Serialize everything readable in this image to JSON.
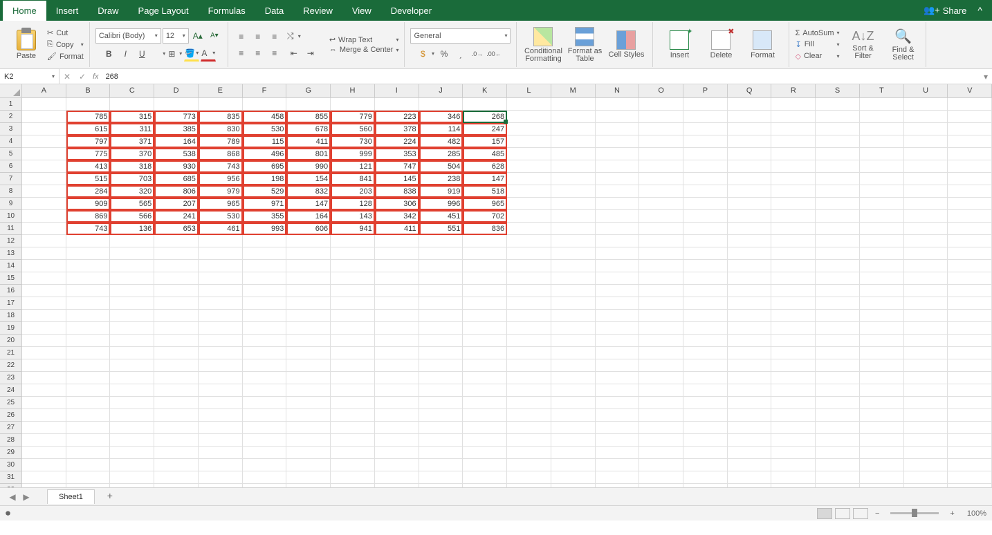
{
  "tabs": [
    "Home",
    "Insert",
    "Draw",
    "Page Layout",
    "Formulas",
    "Data",
    "Review",
    "View",
    "Developer"
  ],
  "share": "Share",
  "clipboard": {
    "paste": "Paste",
    "cut": "Cut",
    "copy": "Copy",
    "format": "Format"
  },
  "font": {
    "name": "Calibri (Body)",
    "size": "12",
    "bold": "B",
    "italic": "I",
    "underline": "U",
    "inc": "A",
    "dec": "A"
  },
  "align": {
    "wrap": "Wrap Text",
    "merge": "Merge & Center"
  },
  "number": {
    "format": "General"
  },
  "styles": {
    "cf": "Conditional Formatting",
    "fat": "Format as Table",
    "cs": "Cell Styles"
  },
  "cells": {
    "insert": "Insert",
    "delete": "Delete",
    "format": "Format"
  },
  "editing": {
    "autosum": "AutoSum",
    "fill": "Fill",
    "clear": "Clear",
    "sort": "Sort & Filter",
    "find": "Find & Select"
  },
  "cellref": "K2",
  "formula_val": "268",
  "columns": [
    "A",
    "B",
    "C",
    "D",
    "E",
    "F",
    "G",
    "H",
    "I",
    "J",
    "K",
    "L",
    "M",
    "N",
    "O",
    "P",
    "Q",
    "R",
    "S",
    "T",
    "U",
    "V"
  ],
  "total_rows": 35,
  "data_rows": [
    [
      785,
      315,
      773,
      835,
      458,
      855,
      779,
      223,
      346,
      268
    ],
    [
      615,
      311,
      385,
      830,
      530,
      678,
      560,
      378,
      114,
      247
    ],
    [
      797,
      371,
      164,
      789,
      115,
      411,
      730,
      224,
      482,
      157
    ],
    [
      775,
      370,
      538,
      868,
      496,
      801,
      999,
      353,
      285,
      485
    ],
    [
      413,
      318,
      930,
      743,
      695,
      990,
      121,
      747,
      504,
      628
    ],
    [
      515,
      703,
      685,
      956,
      198,
      154,
      841,
      145,
      238,
      147
    ],
    [
      284,
      320,
      806,
      979,
      529,
      832,
      203,
      838,
      919,
      518
    ],
    [
      909,
      565,
      207,
      965,
      971,
      147,
      128,
      306,
      996,
      965
    ],
    [
      869,
      566,
      241,
      530,
      355,
      164,
      143,
      342,
      451,
      702
    ],
    [
      743,
      136,
      653,
      461,
      993,
      606,
      941,
      411,
      551,
      836
    ]
  ],
  "selected": {
    "row": 2,
    "col": "K"
  },
  "sheet": "Sheet1",
  "zoom": "100%"
}
